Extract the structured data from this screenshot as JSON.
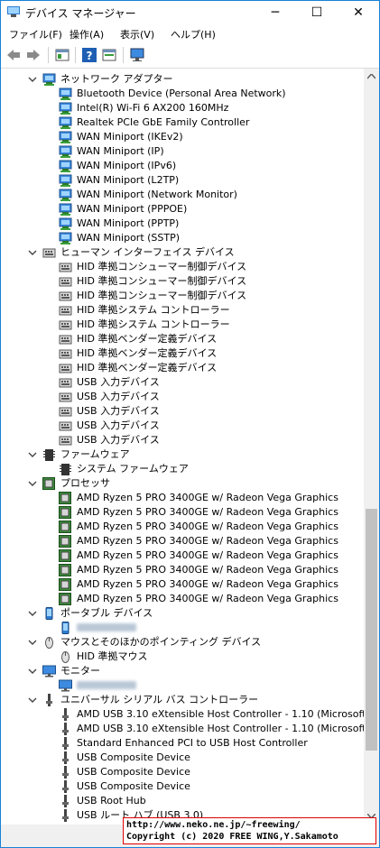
{
  "window": {
    "title": "デバイス マネージャー",
    "controls": {
      "minimize": "─",
      "maximize": "☐",
      "close": "✕"
    }
  },
  "menu": [
    "ファイル(F)",
    "操作(A)",
    "表示(V)",
    "ヘルプ(H)"
  ],
  "toolbar": [
    "back-icon",
    "forward-icon",
    "properties-icon",
    "help-icon",
    "view-icon",
    "monitor-scan-icon"
  ],
  "tree": [
    {
      "level": 0,
      "expanded": true,
      "icon": "network",
      "label": "ネットワーク アダプター"
    },
    {
      "level": 1,
      "icon": "network",
      "label": "Bluetooth Device (Personal Area Network)"
    },
    {
      "level": 1,
      "icon": "network",
      "label": "Intel(R) Wi-Fi 6 AX200 160MHz"
    },
    {
      "level": 1,
      "icon": "network",
      "label": "Realtek PCIe GbE Family Controller"
    },
    {
      "level": 1,
      "icon": "network",
      "label": "WAN Miniport (IKEv2)"
    },
    {
      "level": 1,
      "icon": "network",
      "label": "WAN Miniport (IP)"
    },
    {
      "level": 1,
      "icon": "network",
      "label": "WAN Miniport (IPv6)"
    },
    {
      "level": 1,
      "icon": "network",
      "label": "WAN Miniport (L2TP)"
    },
    {
      "level": 1,
      "icon": "network",
      "label": "WAN Miniport (Network Monitor)"
    },
    {
      "level": 1,
      "icon": "network",
      "label": "WAN Miniport (PPPOE)"
    },
    {
      "level": 1,
      "icon": "network",
      "label": "WAN Miniport (PPTP)"
    },
    {
      "level": 1,
      "icon": "network",
      "label": "WAN Miniport (SSTP)"
    },
    {
      "level": 0,
      "expanded": true,
      "icon": "hid",
      "label": "ヒューマン インターフェイス デバイス"
    },
    {
      "level": 1,
      "icon": "hid",
      "label": "HID 準拠コンシューマー制御デバイス"
    },
    {
      "level": 1,
      "icon": "hid",
      "label": "HID 準拠コンシューマー制御デバイス"
    },
    {
      "level": 1,
      "icon": "hid",
      "label": "HID 準拠コンシューマー制御デバイス"
    },
    {
      "level": 1,
      "icon": "hid",
      "label": "HID 準拠システム コントローラー"
    },
    {
      "level": 1,
      "icon": "hid",
      "label": "HID 準拠システム コントローラー"
    },
    {
      "level": 1,
      "icon": "hid",
      "label": "HID 準拠ベンダー定義デバイス"
    },
    {
      "level": 1,
      "icon": "hid",
      "label": "HID 準拠ベンダー定義デバイス"
    },
    {
      "level": 1,
      "icon": "hid",
      "label": "HID 準拠ベンダー定義デバイス"
    },
    {
      "level": 1,
      "icon": "hid",
      "label": "USB 入力デバイス"
    },
    {
      "level": 1,
      "icon": "hid",
      "label": "USB 入力デバイス"
    },
    {
      "level": 1,
      "icon": "hid",
      "label": "USB 入力デバイス"
    },
    {
      "level": 1,
      "icon": "hid",
      "label": "USB 入力デバイス"
    },
    {
      "level": 1,
      "icon": "hid",
      "label": "USB 入力デバイス"
    },
    {
      "level": 0,
      "expanded": true,
      "icon": "firmware",
      "label": "ファームウェア"
    },
    {
      "level": 1,
      "icon": "firmware",
      "label": "システム ファームウェア"
    },
    {
      "level": 0,
      "expanded": true,
      "icon": "cpu",
      "label": "プロセッサ"
    },
    {
      "level": 1,
      "icon": "cpu",
      "label": "AMD Ryzen 5 PRO 3400GE w/ Radeon Vega Graphics"
    },
    {
      "level": 1,
      "icon": "cpu",
      "label": "AMD Ryzen 5 PRO 3400GE w/ Radeon Vega Graphics"
    },
    {
      "level": 1,
      "icon": "cpu",
      "label": "AMD Ryzen 5 PRO 3400GE w/ Radeon Vega Graphics"
    },
    {
      "level": 1,
      "icon": "cpu",
      "label": "AMD Ryzen 5 PRO 3400GE w/ Radeon Vega Graphics"
    },
    {
      "level": 1,
      "icon": "cpu",
      "label": "AMD Ryzen 5 PRO 3400GE w/ Radeon Vega Graphics"
    },
    {
      "level": 1,
      "icon": "cpu",
      "label": "AMD Ryzen 5 PRO 3400GE w/ Radeon Vega Graphics"
    },
    {
      "level": 1,
      "icon": "cpu",
      "label": "AMD Ryzen 5 PRO 3400GE w/ Radeon Vega Graphics"
    },
    {
      "level": 1,
      "icon": "cpu",
      "label": "AMD Ryzen 5 PRO 3400GE w/ Radeon Vega Graphics"
    },
    {
      "level": 0,
      "expanded": true,
      "icon": "portable",
      "label": "ポータブル デバイス"
    },
    {
      "level": 1,
      "icon": "portable",
      "label": "",
      "blurred": true
    },
    {
      "level": 0,
      "expanded": true,
      "icon": "mouse",
      "label": "マウスとそのほかのポインティング デバイス"
    },
    {
      "level": 1,
      "icon": "mouse",
      "label": "HID 準拠マウス"
    },
    {
      "level": 0,
      "expanded": true,
      "icon": "monitor",
      "label": "モニター"
    },
    {
      "level": 1,
      "icon": "monitor",
      "label": "",
      "blurred": true
    },
    {
      "level": 0,
      "expanded": true,
      "icon": "usb",
      "label": "ユニバーサル シリアル バス コントローラー"
    },
    {
      "level": 1,
      "icon": "usb",
      "label": "AMD USB 3.10 eXtensible Host Controller - 1.10 (Microsoft)"
    },
    {
      "level": 1,
      "icon": "usb",
      "label": "AMD USB 3.10 eXtensible Host Controller - 1.10 (Microsoft)"
    },
    {
      "level": 1,
      "icon": "usb",
      "label": "Standard Enhanced PCI to USB Host Controller"
    },
    {
      "level": 1,
      "icon": "usb",
      "label": "USB Composite Device"
    },
    {
      "level": 1,
      "icon": "usb",
      "label": "USB Composite Device"
    },
    {
      "level": 1,
      "icon": "usb",
      "label": "USB Composite Device"
    },
    {
      "level": 1,
      "icon": "usb",
      "label": "USB Root Hub"
    },
    {
      "level": 1,
      "icon": "usb",
      "label": "USB ルート ハブ (USB 3.0)"
    }
  ],
  "watermark": {
    "line1": "http://www.neko.ne.jp/~freewing/",
    "line2": "Copyright (c) 2020 FREE WING,Y.Sakamoto"
  }
}
